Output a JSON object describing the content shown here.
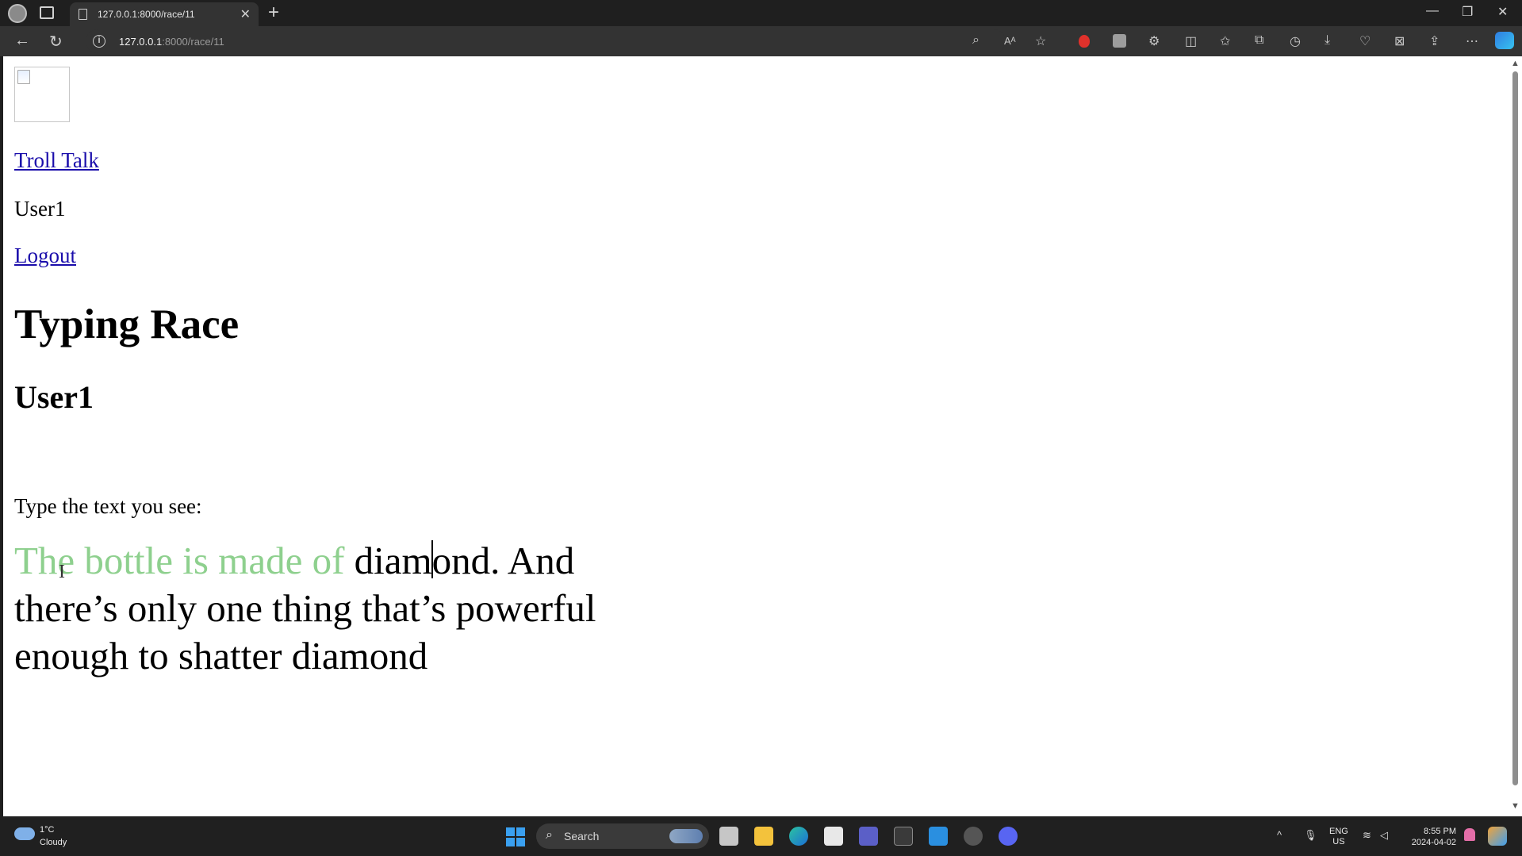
{
  "browser": {
    "tab_title": "127.0.0.1:8000/race/11",
    "url_host": "127.0.0.1",
    "url_rest": ":8000/race/11"
  },
  "page": {
    "nav_home": "Troll Talk",
    "nav_user": "User1",
    "nav_logout": "Logout",
    "heading": "Typing Race",
    "player": "User1",
    "prompt": "Type the text you see:",
    "race_typed": "The bottle is made of ",
    "race_before_caret": "diam",
    "race_after_caret": "ond. And there’s only one thing that’s powerful enough to shatter diamond"
  },
  "taskbar": {
    "weather_temp": "1°C",
    "weather_condition": "Cloudy",
    "search_label": "Search",
    "lang_top": "ENG",
    "lang_bottom": "US",
    "time": "8:55 PM",
    "date": "2024-04-02"
  },
  "colors": {
    "typed_text": "#8ed08e",
    "link": "#1a0dab",
    "chrome_dark": "#1f1f1f"
  }
}
